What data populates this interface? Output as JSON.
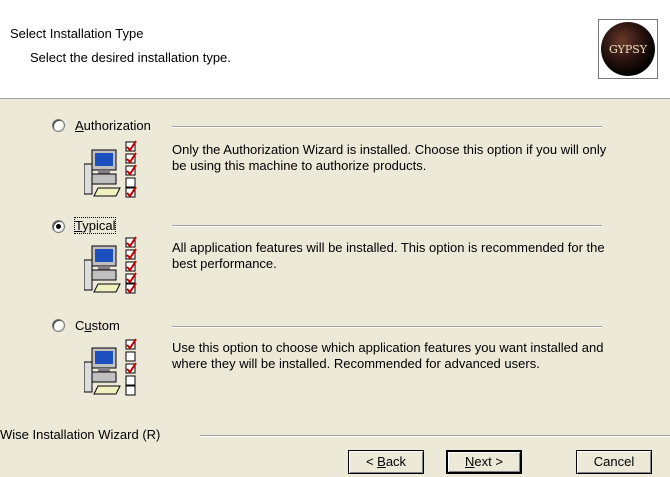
{
  "header": {
    "title": "Select Installation Type",
    "subtitle": "Select the desired installation type.",
    "logo_text": "GYPSY"
  },
  "options": [
    {
      "label_pre": "",
      "label_key": "A",
      "label_post": "uthorization",
      "selected": false,
      "description": "Only the Authorization Wizard is installed. Choose this option if you will only be using this machine to authorize products."
    },
    {
      "label_pre": "",
      "label_key": "T",
      "label_post": "ypical",
      "selected": true,
      "description": "All application features will be installed. This option is recommended for the best performance."
    },
    {
      "label_pre": "C",
      "label_key": "u",
      "label_post": "stom",
      "selected": false,
      "description": "Use this option to choose which application features you want installed and where they will be installed. Recommended for advanced users."
    }
  ],
  "footer": {
    "brand": "Wise Installation Wizard (R)",
    "back_pre": "< ",
    "back_key": "B",
    "back_post": "ack",
    "next_key": "N",
    "next_post": "ext >",
    "cancel": "Cancel"
  }
}
